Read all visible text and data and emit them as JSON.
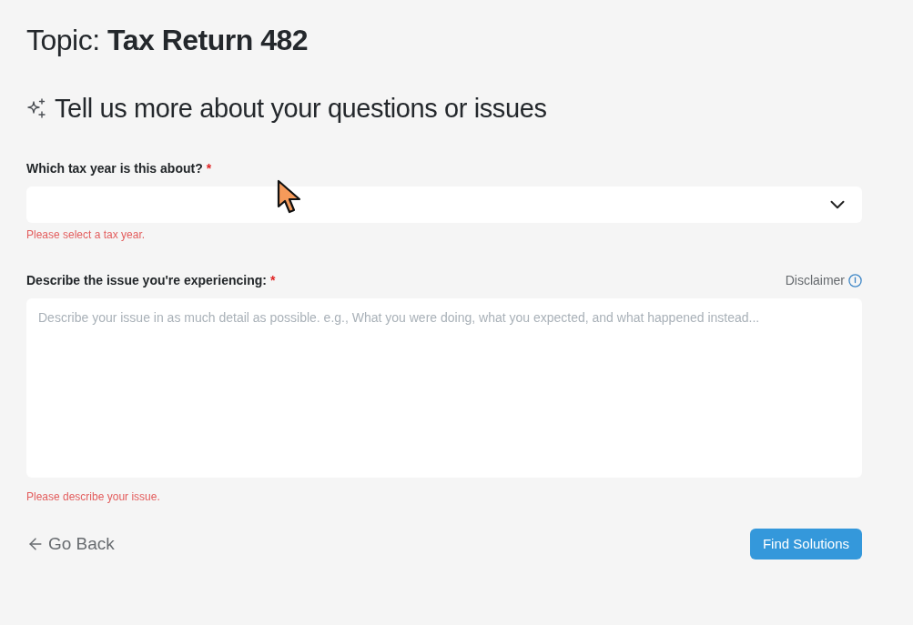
{
  "topic": {
    "heading": "Topic: **Tax Return 482**"
  },
  "section": {
    "heading": "Tell us more about your questions or issues"
  },
  "fields": [
    {
      "kind": "select",
      "label": "Which tax year is this about?",
      "required_mark": "*",
      "error": "Please select a tax year."
    },
    {
      "kind": "textarea",
      "label": "Describe the issue you're experiencing:",
      "required_mark": "*",
      "aside": "Disclaimer",
      "placeholder": "Describe your issue in as much detail as possible. e.g., What you were doing, what you expected, and what happened instead...",
      "error": "Please describe your issue."
    }
  ],
  "actions": {
    "back": "Go Back",
    "submit": "Find Solutions"
  }
}
